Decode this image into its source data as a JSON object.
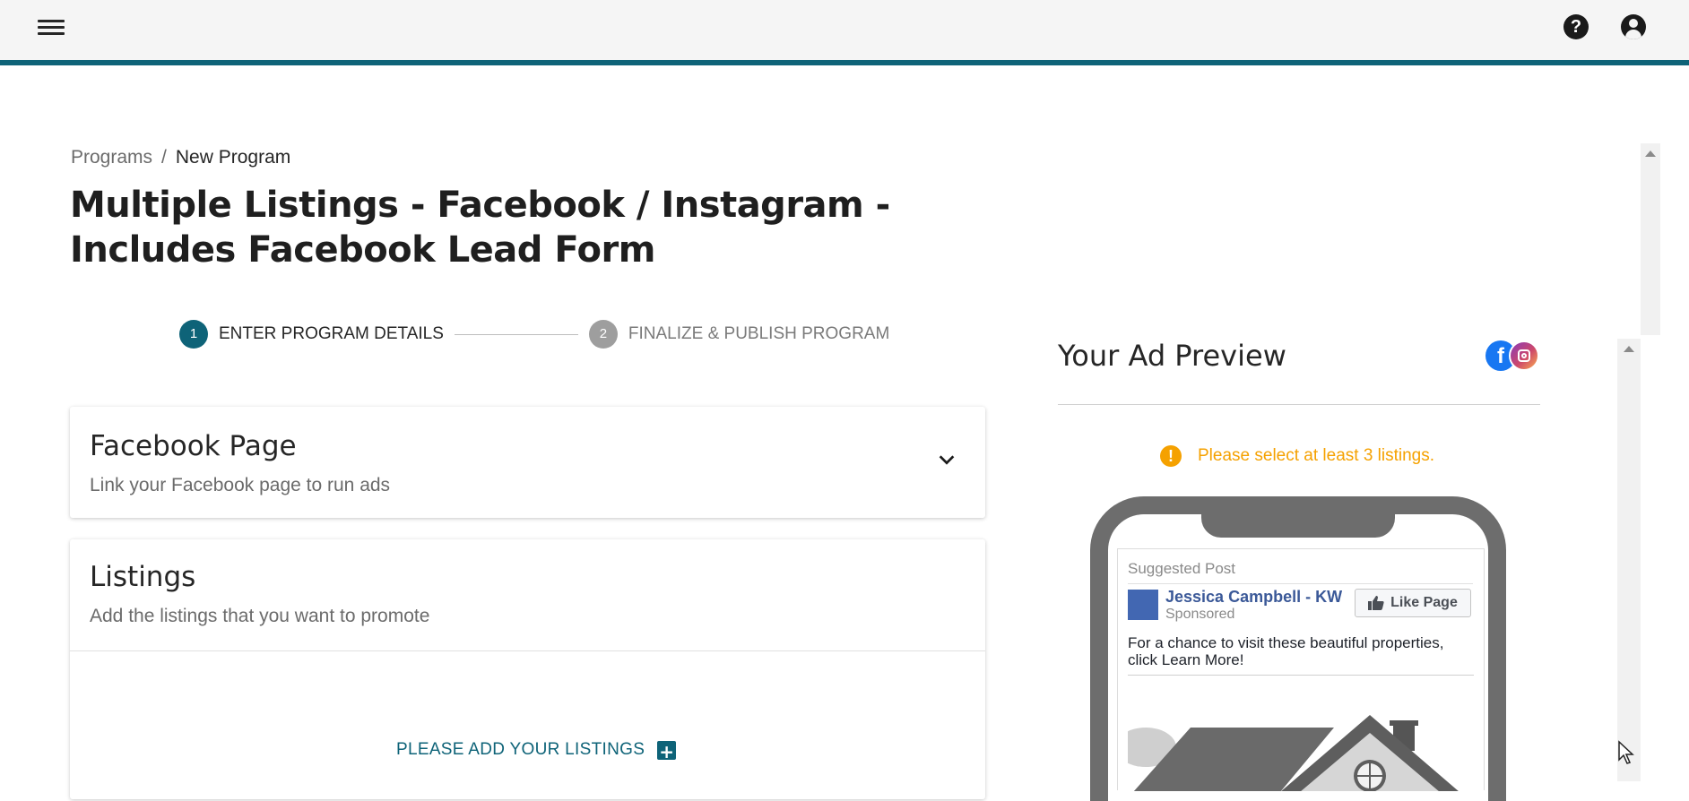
{
  "header": {
    "menu_icon": "hamburger-menu-icon",
    "help_icon": "question-mark-icon",
    "help_glyph": "?",
    "account_icon": "account-circle-icon",
    "accent_color": "#0e6378"
  },
  "breadcrumb": {
    "parent": "Programs",
    "separator": "/",
    "current": "New Program"
  },
  "page_title": "Multiple Listings - Facebook / Instagram - Includes Facebook Lead Form",
  "stepper": {
    "steps": [
      {
        "number": "1",
        "label": "ENTER PROGRAM DETAILS",
        "state": "active"
      },
      {
        "number": "2",
        "label": "FINALIZE & PUBLISH PROGRAM",
        "state": "inactive"
      }
    ]
  },
  "facebook_card": {
    "title": "Facebook Page",
    "subtitle": "Link your Facebook page to run ads",
    "toggle_icon": "chevron-down-icon"
  },
  "listings_card": {
    "title": "Listings",
    "subtitle": "Add the listings that you want to promote",
    "add_label": "PLEASE ADD YOUR LISTINGS",
    "add_icon": "plus-square-icon",
    "add_glyph": "+"
  },
  "preview": {
    "title": "Your Ad Preview",
    "platforms": [
      "facebook-icon",
      "instagram-icon"
    ],
    "warning_icon": "warning-circle-icon",
    "warning_glyph": "!",
    "warning_text": "Please select at least 3 listings.",
    "warning_color": "#f5a100",
    "post": {
      "suggested_label": "Suggested Post",
      "page_name": "Jessica Campbell - KW",
      "sponsored_label": "Sponsored",
      "like_button": "Like Page",
      "body_text": "For a chance to visit these beautiful properties, click Learn More!",
      "image": "house-illustration"
    }
  }
}
